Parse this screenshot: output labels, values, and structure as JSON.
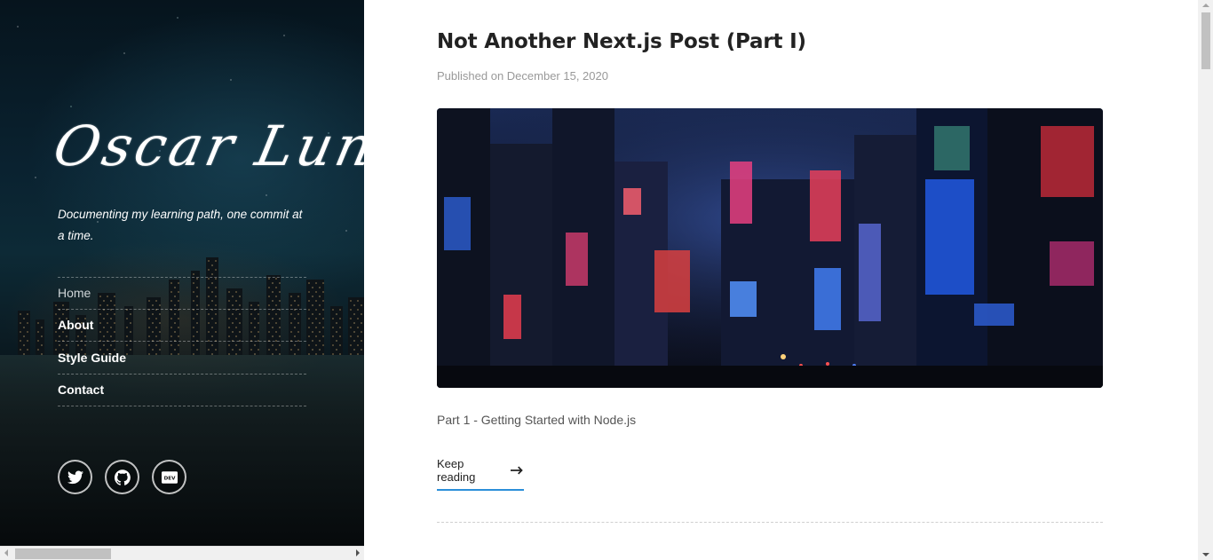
{
  "sidebar": {
    "logo_text": "Oscar Luna",
    "tagline": "Documenting my learning path, one commit at a time.",
    "nav": [
      {
        "label": "Home",
        "active": true
      },
      {
        "label": "About",
        "active": false
      },
      {
        "label": "Style Guide",
        "active": false
      },
      {
        "label": "Contact",
        "active": false
      }
    ],
    "social": [
      {
        "icon": "twitter-icon"
      },
      {
        "icon": "github-icon"
      },
      {
        "icon": "dev-icon",
        "label": "DEV"
      }
    ]
  },
  "post": {
    "title": "Not Another Next.js Post (Part I)",
    "date": "Published on December 15, 2020",
    "image_icon": "city-street-night-image",
    "excerpt": "Part 1 - Getting Started with Node.js",
    "cta": "Keep reading"
  },
  "colors": {
    "accent": "#2b8ed9",
    "title": "#222222",
    "muted": "#999999"
  }
}
